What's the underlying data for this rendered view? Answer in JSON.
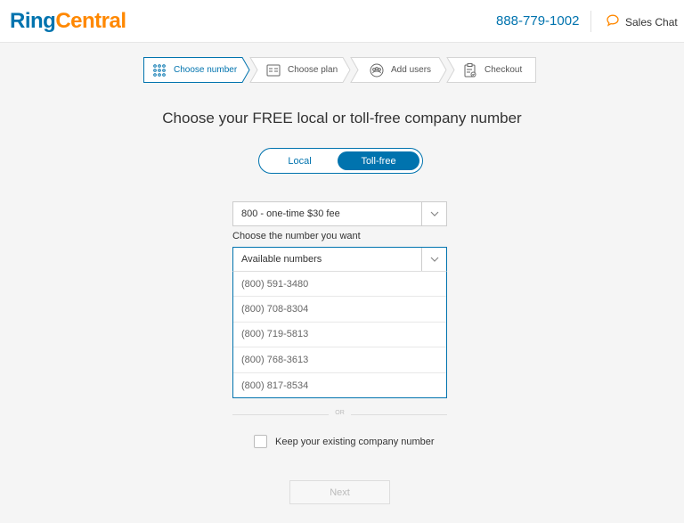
{
  "header": {
    "logo_ring": "Ring",
    "logo_central": "Central",
    "phone": "888-779-1002",
    "chat_label": "Sales Chat"
  },
  "stepper": {
    "steps": [
      {
        "label": "Choose number",
        "icon": "grid-dots-icon",
        "active": true
      },
      {
        "label": "Choose plan",
        "icon": "plan-board-icon",
        "active": false
      },
      {
        "label": "Add users",
        "icon": "users-group-icon",
        "active": false
      },
      {
        "label": "Checkout",
        "icon": "clipboard-check-icon",
        "active": false
      }
    ]
  },
  "title": "Choose your FREE local or toll-free company number",
  "toggle": {
    "local": "Local",
    "tollfree": "Toll-free",
    "selected": "Toll-free"
  },
  "prefix_select": {
    "value": "800 - one-time $30 fee"
  },
  "number_label": "Choose the number you want",
  "number_select": {
    "placeholder": "Available numbers"
  },
  "numbers": [
    "(800) 591-3480",
    "(800) 708-8304",
    "(800) 719-5813",
    "(800) 768-3613",
    "(800) 817-8534"
  ],
  "or_text": "OR",
  "keep_label": "Keep your existing company number",
  "next_label": "Next",
  "colors": {
    "brand_blue": "#0073ae",
    "brand_orange": "#ff8800"
  }
}
